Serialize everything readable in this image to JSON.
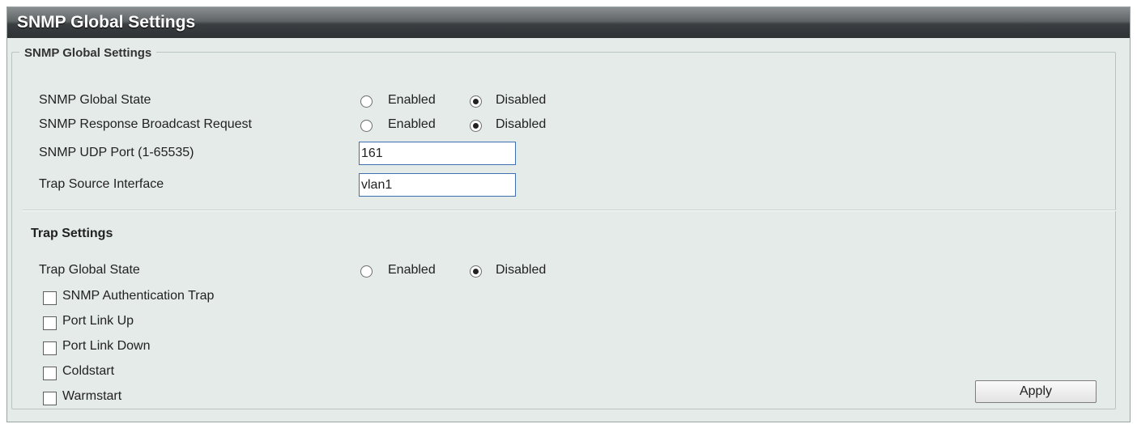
{
  "window": {
    "title": "SNMP Global Settings"
  },
  "global": {
    "legend": "SNMP Global Settings",
    "rows": [
      {
        "label": "SNMP Global State",
        "options": [
          "Enabled",
          "Disabled"
        ],
        "selected": "Disabled"
      },
      {
        "label": "SNMP Response Broadcast Request",
        "options": [
          "Enabled",
          "Disabled"
        ],
        "selected": "Disabled"
      }
    ],
    "udp_port": {
      "label": "SNMP UDP Port (1-65535)",
      "value": "161"
    },
    "trap_source": {
      "label": "Trap Source Interface",
      "value": "vlan1"
    }
  },
  "trap": {
    "title": "Trap Settings",
    "global_state": {
      "label": "Trap Global State",
      "options": [
        "Enabled",
        "Disabled"
      ],
      "selected": "Disabled"
    },
    "checkboxes": [
      {
        "label": "SNMP Authentication Trap",
        "checked": false
      },
      {
        "label": "Port Link Up",
        "checked": false
      },
      {
        "label": "Port Link Down",
        "checked": false
      },
      {
        "label": "Coldstart",
        "checked": false
      },
      {
        "label": "Warmstart",
        "checked": false
      }
    ]
  },
  "actions": {
    "apply_label": "Apply"
  }
}
